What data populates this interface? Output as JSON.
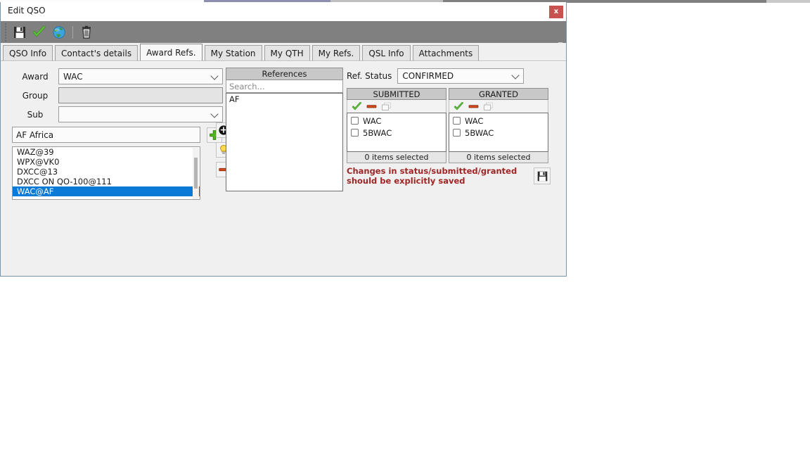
{
  "window": {
    "title": "Edit QSO",
    "close_label": "x",
    "collapse_label": "_"
  },
  "toolbar": {
    "items": [
      {
        "name": "save-icon",
        "tooltip": "Save"
      },
      {
        "name": "confirm-check-icon",
        "tooltip": "Confirm"
      },
      {
        "name": "globe-icon",
        "tooltip": "Lookup"
      },
      {
        "name": "delete-trash-icon",
        "tooltip": "Delete"
      }
    ]
  },
  "tabs": [
    {
      "label": "QSO Info",
      "active": false
    },
    {
      "label": "Contact's details",
      "active": false
    },
    {
      "label": "Award Refs.",
      "active": true
    },
    {
      "label": "My Station",
      "active": false
    },
    {
      "label": "My QTH",
      "active": false
    },
    {
      "label": "My Refs.",
      "active": false
    },
    {
      "label": "QSL Info",
      "active": false
    },
    {
      "label": "Attachments",
      "active": false
    }
  ],
  "award_form": {
    "award_label": "Award",
    "award_value": "WAC",
    "group_label": "Group",
    "group_value": "",
    "sub_label": "Sub",
    "sub_value": "",
    "ref_name_value": "AF Africa",
    "add_button_label": "+",
    "list_items": [
      {
        "label": "WAZ@39",
        "selected": false
      },
      {
        "label": "WPX@VK0",
        "selected": false
      },
      {
        "label": "DXCC@13",
        "selected": false
      },
      {
        "label": "DXCC ON QO-100@111",
        "selected": false
      },
      {
        "label": "WAC@AF",
        "selected": true
      }
    ],
    "side_buttons": [
      {
        "name": "add-reference-button",
        "icon": "green-plus-icon"
      },
      {
        "name": "locate-reference-button",
        "icon": "black-circle-plus-icon"
      },
      {
        "name": "hint-reference-button",
        "icon": "lightbulb-icon"
      },
      {
        "name": "remove-reference-button",
        "icon": "red-minus-icon"
      }
    ]
  },
  "references": {
    "header": "References",
    "search_placeholder": "Search...",
    "items": [
      {
        "label": "AF"
      }
    ]
  },
  "status_panel": {
    "ref_status_label": "Ref. Status",
    "ref_status_value": "CONFIRMED",
    "columns": [
      {
        "title": "SUBMITTED",
        "tools": [
          {
            "name": "select-all-icon",
            "enabled": true
          },
          {
            "name": "deselect-all-icon",
            "enabled": true
          },
          {
            "name": "copy-icon",
            "enabled": false
          }
        ],
        "items": [
          {
            "label": "WAC",
            "checked": false
          },
          {
            "label": "5BWAC",
            "checked": false
          }
        ],
        "footer": "0 items selected"
      },
      {
        "title": "GRANTED",
        "tools": [
          {
            "name": "select-all-icon",
            "enabled": true
          },
          {
            "name": "deselect-all-icon",
            "enabled": true
          },
          {
            "name": "copy-icon",
            "enabled": false
          }
        ],
        "items": [
          {
            "label": "WAC",
            "checked": false
          },
          {
            "label": "5BWAC",
            "checked": false
          }
        ],
        "footer": "0 items selected"
      }
    ],
    "warning": "Changes in status/submitted/granted\nshould be explicitly saved",
    "save_button_name": "save-status-button"
  },
  "colors": {
    "toolbar_bg": "#808080",
    "dialog_bg": "#f0f0f0",
    "selection_blue": "#0a7ad6",
    "warning_red": "#a02525",
    "close_red": "#c9514f",
    "header_gray": "#c8c8c8"
  }
}
